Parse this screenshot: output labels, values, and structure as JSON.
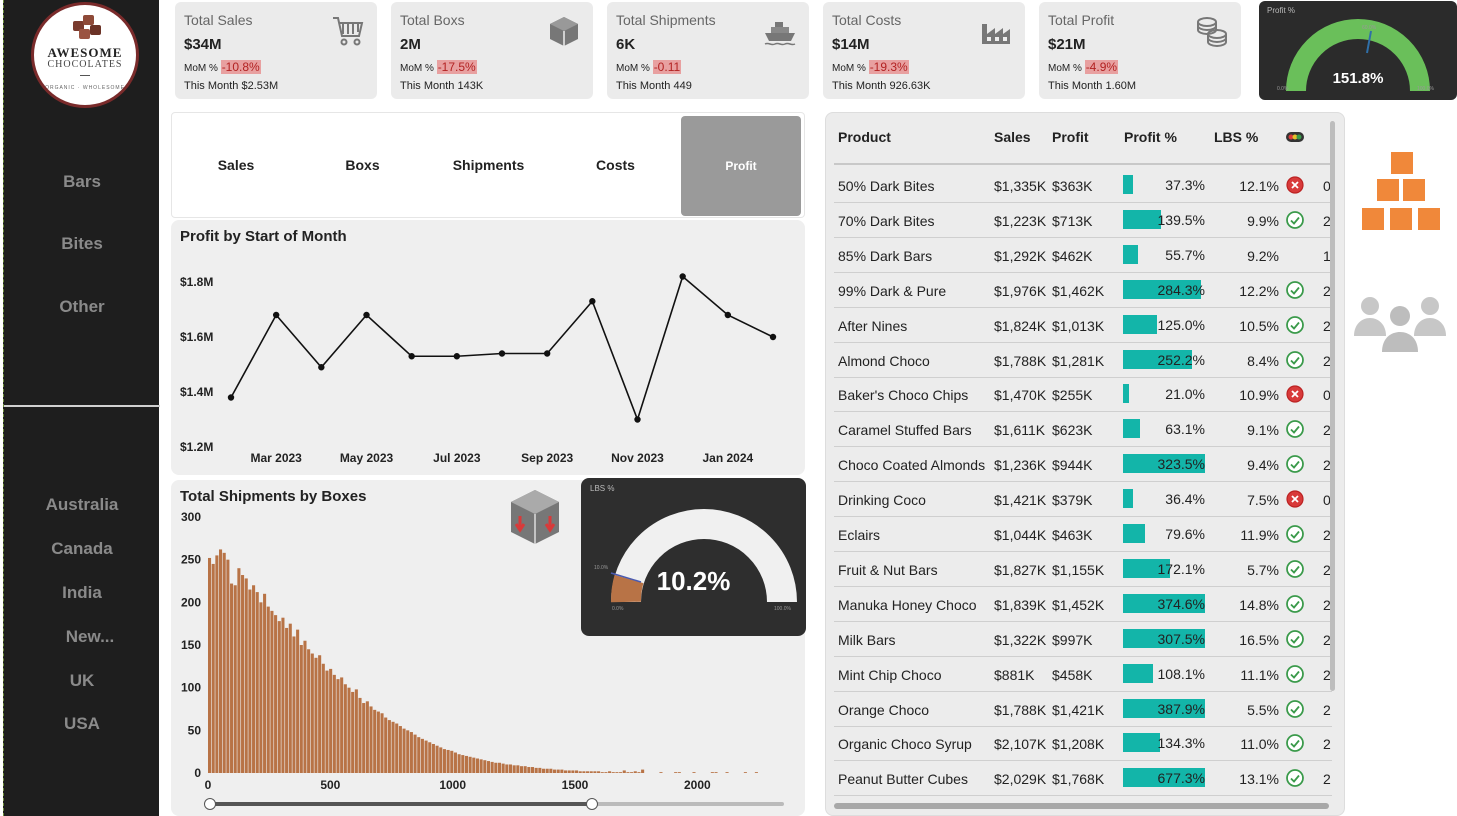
{
  "brand": {
    "line1": "AWESOME",
    "line2": "CHOCOLATES",
    "tagline": "ORGANIC · WHOLESOME"
  },
  "sidebar": {
    "categories": [
      "Bars",
      "Bites",
      "Other"
    ],
    "countries": [
      "Australia",
      "Canada",
      "India",
      "New...",
      "UK",
      "USA"
    ]
  },
  "kpis": [
    {
      "title": "Total Sales",
      "value": "$34M",
      "mom_label": "MoM %",
      "mom": "-10.8%",
      "month": "This Month $2.53M",
      "icon": "cart-icon"
    },
    {
      "title": "Total Boxs",
      "value": "2M",
      "mom_label": "MoM %",
      "mom": "-17.5%",
      "month": "This Month 143K",
      "icon": "box-icon"
    },
    {
      "title": "Total Shipments",
      "value": "6K",
      "mom_label": "MoM %",
      "mom": "-0.11",
      "month": "This Month 449",
      "icon": "ship-icon"
    },
    {
      "title": "Total Costs",
      "value": "$14M",
      "mom_label": "MoM %",
      "mom": "-19.3%",
      "month": "This Month 926.63K",
      "icon": "factory-icon"
    },
    {
      "title": "Total Profit",
      "value": "$21M",
      "mom_label": "MoM %",
      "mom": "-4.9%",
      "month": "This Month 1.60M",
      "icon": "coins-icon"
    }
  ],
  "profit_gauge": {
    "label": "Profit %",
    "value": "151.8%",
    "min": "0.0%",
    "max": "100.0%",
    "target": "60.0%",
    "fill_fraction": 1.0
  },
  "tabs": [
    "Sales",
    "Boxs",
    "Shipments",
    "Costs",
    "Profit"
  ],
  "active_tab": "Profit",
  "line_panel": {
    "title": "Profit by Start of Month"
  },
  "hist_panel": {
    "title": "Total Shipments by Boxes"
  },
  "lbs_gauge": {
    "label": "LBS %",
    "value": "10.2%",
    "min": "0.0%",
    "max": "100.0%",
    "target": "10.0%",
    "fill_fraction": 0.102
  },
  "chart_data": [
    {
      "type": "line",
      "title": "Profit by Start of Month",
      "x": [
        "Feb 2023",
        "Mar 2023",
        "Apr 2023",
        "May 2023",
        "Jun 2023",
        "Jul 2023",
        "Aug 2023",
        "Sep 2023",
        "Oct 2023",
        "Nov 2023",
        "Dec 2023",
        "Jan 2024",
        "Feb 2024"
      ],
      "x_tick_labels": [
        "Mar 2023",
        "May 2023",
        "Jul 2023",
        "Sep 2023",
        "Nov 2023",
        "Jan 2024"
      ],
      "y": [
        1.38,
        1.68,
        1.49,
        1.68,
        1.53,
        1.53,
        1.54,
        1.54,
        1.73,
        1.3,
        1.82,
        1.68,
        1.6
      ],
      "y_tick_labels": [
        "$1.2M",
        "$1.4M",
        "$1.6M",
        "$1.8M"
      ],
      "ylim": [
        1.2,
        1.8
      ],
      "y_unit": "$M"
    },
    {
      "type": "bar",
      "title": "Total Shipments by Boxes",
      "x_tick_labels": [
        "0",
        "500",
        "1000",
        "1500",
        "2000"
      ],
      "y_tick_labels": [
        "0",
        "50",
        "100",
        "150",
        "200",
        "250",
        "300"
      ],
      "xlim": [
        0,
        2350
      ],
      "ylim": [
        0,
        300
      ],
      "bin_width": 15,
      "values": [
        252,
        245,
        255,
        262,
        258,
        250,
        222,
        220,
        240,
        232,
        228,
        215,
        220,
        212,
        200,
        210,
        195,
        190,
        185,
        178,
        182,
        170,
        175,
        160,
        168,
        150,
        155,
        145,
        140,
        135,
        138,
        128,
        120,
        122,
        115,
        110,
        112,
        104,
        100,
        95,
        98,
        88,
        82,
        84,
        78,
        74,
        72,
        70,
        65,
        62,
        60,
        58,
        55,
        52,
        50,
        48,
        45,
        42,
        40,
        38,
        36,
        34,
        32,
        30,
        28,
        27,
        26,
        24,
        22,
        21,
        20,
        19,
        18,
        17,
        16,
        15,
        14,
        13,
        12,
        12,
        11,
        10,
        10,
        9,
        9,
        8,
        8,
        7,
        7,
        6,
        6,
        5,
        5,
        5,
        4,
        4,
        4,
        3,
        3,
        3,
        3,
        2,
        2,
        2,
        2,
        2,
        2,
        1,
        1,
        2,
        1,
        1,
        1,
        3,
        1,
        1,
        2,
        1,
        4,
        0,
        0,
        0,
        0,
        1,
        0,
        0,
        0,
        1,
        1,
        0,
        0,
        0,
        1,
        0,
        0,
        0,
        0,
        1,
        1,
        0,
        0,
        1,
        0,
        0,
        0,
        0,
        1,
        0,
        0,
        1
      ]
    }
  ],
  "slider": {
    "from": 0,
    "to": 1550
  },
  "table": {
    "headers": [
      "Product",
      "Sales",
      "Profit",
      "Profit %",
      "LBS %"
    ],
    "rows": [
      {
        "product": "50% Dark Bites",
        "sales": "$1,335K",
        "profit": "$363K",
        "profit_pct": "37.3%",
        "profit_pct_num": 37.3,
        "lbs": "12.1%",
        "status": "bad",
        "extra": "0"
      },
      {
        "product": "70% Dark Bites",
        "sales": "$1,223K",
        "profit": "$713K",
        "profit_pct": "139.5%",
        "profit_pct_num": 139.5,
        "lbs": "9.9%",
        "status": "ok",
        "extra": "2"
      },
      {
        "product": "85% Dark Bars",
        "sales": "$1,292K",
        "profit": "$462K",
        "profit_pct": "55.7%",
        "profit_pct_num": 55.7,
        "lbs": "9.2%",
        "status": "none",
        "extra": "1"
      },
      {
        "product": "99% Dark & Pure",
        "sales": "$1,976K",
        "profit": "$1,462K",
        "profit_pct": "284.3%",
        "profit_pct_num": 284.3,
        "lbs": "12.2%",
        "status": "ok",
        "extra": "2"
      },
      {
        "product": "After Nines",
        "sales": "$1,824K",
        "profit": "$1,013K",
        "profit_pct": "125.0%",
        "profit_pct_num": 125.0,
        "lbs": "10.5%",
        "status": "ok",
        "extra": "2"
      },
      {
        "product": "Almond Choco",
        "sales": "$1,788K",
        "profit": "$1,281K",
        "profit_pct": "252.2%",
        "profit_pct_num": 252.2,
        "lbs": "8.4%",
        "status": "ok",
        "extra": "2"
      },
      {
        "product": "Baker's Choco Chips",
        "sales": "$1,470K",
        "profit": "$255K",
        "profit_pct": "21.0%",
        "profit_pct_num": 21.0,
        "lbs": "10.9%",
        "status": "bad",
        "extra": "0"
      },
      {
        "product": "Caramel Stuffed Bars",
        "sales": "$1,611K",
        "profit": "$623K",
        "profit_pct": "63.1%",
        "profit_pct_num": 63.1,
        "lbs": "9.1%",
        "status": "ok",
        "extra": "2"
      },
      {
        "product": "Choco Coated Almonds",
        "sales": "$1,236K",
        "profit": "$944K",
        "profit_pct": "323.5%",
        "profit_pct_num": 323.5,
        "lbs": "9.4%",
        "status": "ok",
        "extra": "2"
      },
      {
        "product": "Drinking Coco",
        "sales": "$1,421K",
        "profit": "$379K",
        "profit_pct": "36.4%",
        "profit_pct_num": 36.4,
        "lbs": "7.5%",
        "status": "bad",
        "extra": "0"
      },
      {
        "product": "Eclairs",
        "sales": "$1,044K",
        "profit": "$463K",
        "profit_pct": "79.6%",
        "profit_pct_num": 79.6,
        "lbs": "11.9%",
        "status": "ok",
        "extra": "2"
      },
      {
        "product": "Fruit & Nut Bars",
        "sales": "$1,827K",
        "profit": "$1,155K",
        "profit_pct": "172.1%",
        "profit_pct_num": 172.1,
        "lbs": "5.7%",
        "status": "ok",
        "extra": "2"
      },
      {
        "product": "Manuka Honey Choco",
        "sales": "$1,839K",
        "profit": "$1,452K",
        "profit_pct": "374.6%",
        "profit_pct_num": 374.6,
        "lbs": "14.8%",
        "status": "ok",
        "extra": "2"
      },
      {
        "product": "Milk Bars",
        "sales": "$1,322K",
        "profit": "$997K",
        "profit_pct": "307.5%",
        "profit_pct_num": 307.5,
        "lbs": "16.5%",
        "status": "ok",
        "extra": "2"
      },
      {
        "product": "Mint Chip Choco",
        "sales": "$881K",
        "profit": "$458K",
        "profit_pct": "108.1%",
        "profit_pct_num": 108.1,
        "lbs": "11.1%",
        "status": "ok",
        "extra": "2"
      },
      {
        "product": "Orange Choco",
        "sales": "$1,788K",
        "profit": "$1,421K",
        "profit_pct": "387.9%",
        "profit_pct_num": 387.9,
        "lbs": "5.5%",
        "status": "ok",
        "extra": "2"
      },
      {
        "product": "Organic Choco Syrup",
        "sales": "$2,107K",
        "profit": "$1,208K",
        "profit_pct": "134.3%",
        "profit_pct_num": 134.3,
        "lbs": "11.0%",
        "status": "ok",
        "extra": "2"
      },
      {
        "product": "Peanut Butter Cubes",
        "sales": "$2,029K",
        "profit": "$1,768K",
        "profit_pct": "677.3%",
        "profit_pct_num": 677.3,
        "lbs": "13.1%",
        "status": "ok",
        "extra": "2"
      }
    ]
  },
  "colors": {
    "accent": "#13b5a9",
    "gauge_green": "#6abf5a",
    "hist_bar": "#b87346",
    "box_orange": "#f0883a",
    "negative_bg": "#e8a0a0",
    "sidebar_bg": "#1e1e1e"
  }
}
